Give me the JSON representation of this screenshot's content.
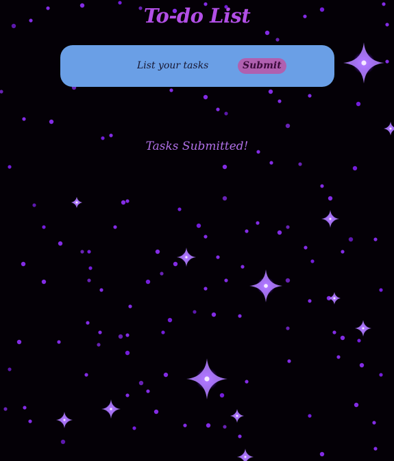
{
  "page": {
    "title": "To-do List"
  },
  "task_form": {
    "input_placeholder": "List your tasks",
    "input_value": "",
    "submit_label": "Submit"
  },
  "status": {
    "message": "Tasks Submitted!"
  },
  "colors": {
    "background": "#040006",
    "title": "#b24fe6",
    "form_background": "#6a9fe6",
    "submit_background": "#b060b0",
    "status_text": "#b070e6",
    "star": "#9a3cff"
  }
}
